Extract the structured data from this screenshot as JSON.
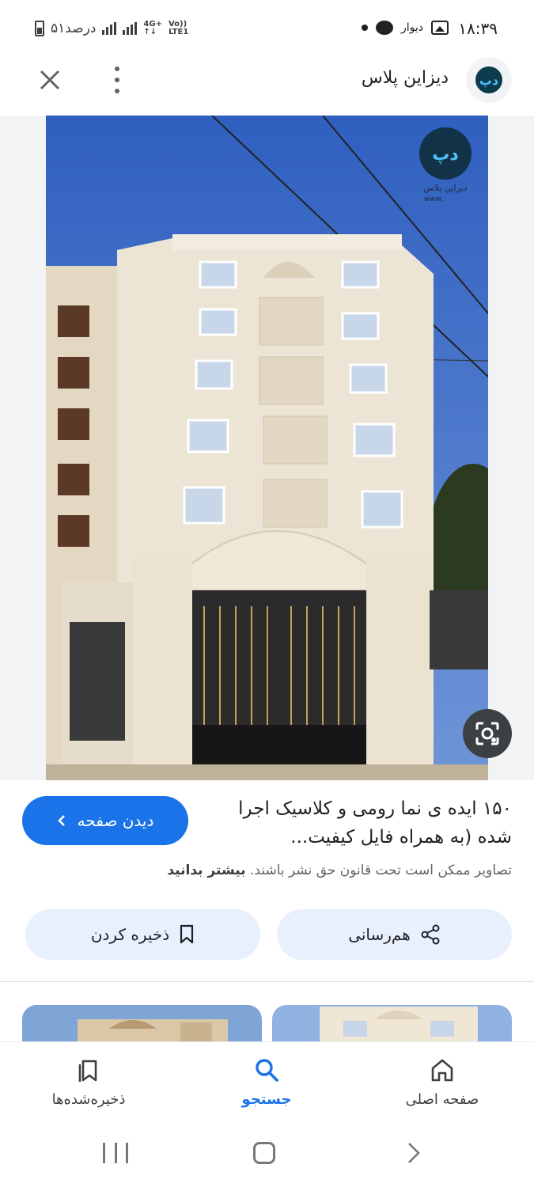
{
  "status_bar": {
    "time": "۱۸:۳۹",
    "app_label": "دیوار",
    "battery_text": "۵۱درصد",
    "network_1": "4G+",
    "network_2": "Vo))",
    "network_3": "LTE1"
  },
  "header": {
    "site_name": "دیزاین پلاس",
    "logo_text": "دپ"
  },
  "image": {
    "watermark_text": "دیزاین پلاس",
    "watermark_url": "www."
  },
  "result": {
    "title": "۱۵۰ ایده ی نما رومی و کلاسیک اجرا شده (به همراه فایل کیفیت...",
    "visit_label": "دیدن صفحه",
    "copyright_text": "تصاویر ممکن است تحت قانون حق نشر باشند. ",
    "learn_more": "بیشتر بدانید",
    "share_label": "هم‌رسانی",
    "save_label": "ذخیره کردن"
  },
  "bottom_nav": {
    "home": "صفحه اصلی",
    "search": "جستجو",
    "saved": "ذخیره‌شده‌ها"
  },
  "colors": {
    "accent": "#1a73e8",
    "pill_bg": "#e8f0fe",
    "sky": "#3d6cc9",
    "facade": "#e9e1d1"
  }
}
